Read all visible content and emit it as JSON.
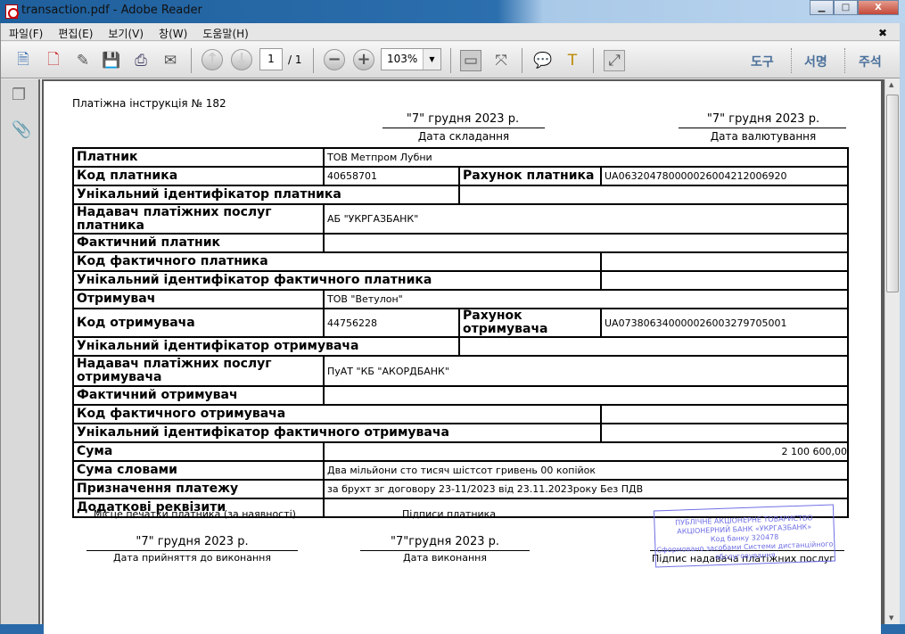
{
  "window": {
    "title": "transaction.pdf - Adobe Reader",
    "minimize": "▁",
    "maximize": "□",
    "close": "X"
  },
  "menu": [
    "파일(F)",
    "편집(E)",
    "보기(V)",
    "창(W)",
    "도움말(H)"
  ],
  "menu_close": "✖",
  "toolbar": {
    "page_current": "1",
    "page_total": "/ 1",
    "zoom": "103%",
    "zoom_dropdown": "▼",
    "right_links": [
      "도구",
      "서명",
      "주석"
    ]
  },
  "doc": {
    "title": "Платіжна інструкція № 182",
    "date_created": "\"7\" грудня 2023 р.",
    "date_created_label": "Дата складання",
    "date_value": "\"7\" грудня 2023 р.",
    "date_value_label": "Дата валютування",
    "rows": {
      "payer": {
        "label": "Платник",
        "value": "ТОВ Метпром Лубни"
      },
      "payer_code": {
        "label": "Код платника",
        "value": "40658701",
        "acc_label": "Рахунок платника",
        "acc_value": "UA063204780000026004212006920"
      },
      "payer_uid": {
        "label": "Унікальний ідентифікатор платника",
        "value": ""
      },
      "payer_psp": {
        "label": "Надавач платіжних послуг платника",
        "value": "АБ \"УКРГАЗБАНК\""
      },
      "actual_payer": {
        "label": "Фактичний платник",
        "value": ""
      },
      "actual_payer_code": {
        "label": "Код фактичного платника",
        "value": ""
      },
      "actual_payer_uid": {
        "label": "Унікальний ідентифікатор фактичного платника",
        "value": ""
      },
      "recipient": {
        "label": "Отримувач",
        "value": "ТОВ \"Ветулон\""
      },
      "recipient_code": {
        "label": "Код отримувача",
        "value": "44756228",
        "acc_label": "Рахунок отримувача",
        "acc_value": "UA073806340000026003279705001"
      },
      "recipient_uid": {
        "label": "Унікальний ідентифікатор отримувача",
        "value": ""
      },
      "recipient_psp": {
        "label": "Надавач платіжних послуг отримувача",
        "value": "ПуАТ \"КБ \"АКОРДБАНК\""
      },
      "actual_recipient": {
        "label": "Фактичний отримувач",
        "value": ""
      },
      "actual_recipient_code": {
        "label": "Код фактичного отримувача",
        "value": ""
      },
      "actual_recipient_uid": {
        "label": "Унікальний ідентифікатор фактичного отримувача",
        "value": ""
      },
      "amount": {
        "label": "Сума",
        "value": "2 100 600,00"
      },
      "amount_words": {
        "label": "Сума словами",
        "value": "Два мільйони сто тисяч шістсот гривень 00 копійок"
      },
      "purpose": {
        "label": "Призначення платежу",
        "value": "за брухт зг договору 23-11/2023 від 23.11.2023року Без ПДВ"
      },
      "extra": {
        "label": "Додаткові реквізити",
        "value": ""
      }
    },
    "stamp_place": "Місце печатки платника (за наявності)",
    "payer_signatures": "Підписи платника",
    "date_accepted": "\"7\" грудня 2023 р.",
    "date_accepted_label": "Дата прийняття до виконання",
    "date_executed": "\"7\"грудня 2023 р.",
    "date_executed_label": "Дата виконання",
    "psp_signature_label": "Підпис надавача платіжних послуг",
    "stamp": [
      "ПУБЛІЧНЕ АКЦІОНЕРНЕ ТОВАРИСТВО",
      "АКЦІОНЕРНИЙ БАНК «УКРГАЗБАНК»",
      "Код банку 320478",
      "Сформовано засобами Системи дистанційного",
      "обслуговування"
    ],
    "stamp_color": "#6f6fe6"
  }
}
